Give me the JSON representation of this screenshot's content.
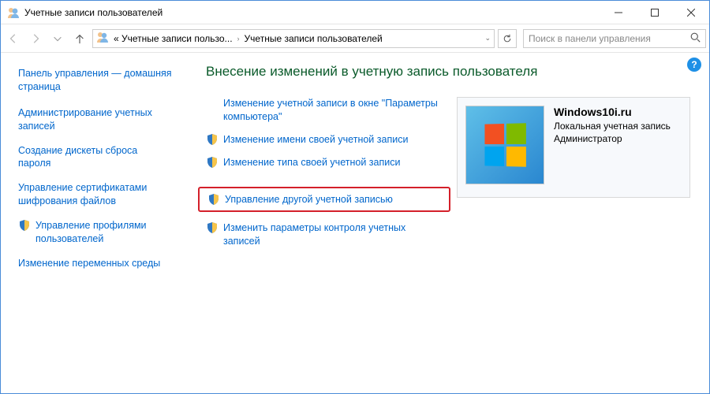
{
  "titlebar": {
    "title": "Учетные записи пользователей"
  },
  "breadcrumb": {
    "segment1": "« Учетные записи пользо...",
    "segment2": "Учетные записи пользователей"
  },
  "search": {
    "placeholder": "Поиск в панели управления"
  },
  "sidebar": {
    "home": "Панель управления — домашняя страница",
    "items": [
      {
        "label": "Администрирование учетных записей"
      },
      {
        "label": "Создание дискеты сброса пароля"
      },
      {
        "label": "Управление сертификатами шифрования файлов"
      },
      {
        "label": "Управление профилями пользователей",
        "shield": true,
        "current": true
      },
      {
        "label": "Изменение переменных среды"
      }
    ]
  },
  "page": {
    "heading": "Внесение изменений в учетную запись пользователя",
    "actions": [
      {
        "label": "Изменение учетной записи в окне \"Параметры компьютера\"",
        "shield": false
      },
      {
        "label": "Изменение имени своей учетной записи",
        "shield": true
      },
      {
        "label": "Изменение типа своей учетной записи",
        "shield": true
      },
      {
        "label": "Управление другой учетной записью",
        "shield": true,
        "highlight": true
      },
      {
        "label": "Изменить параметры контроля учетных записей",
        "shield": true
      }
    ]
  },
  "usercard": {
    "name": "Windows10i.ru",
    "line1": "Локальная учетная запись",
    "line2": "Администратор"
  }
}
